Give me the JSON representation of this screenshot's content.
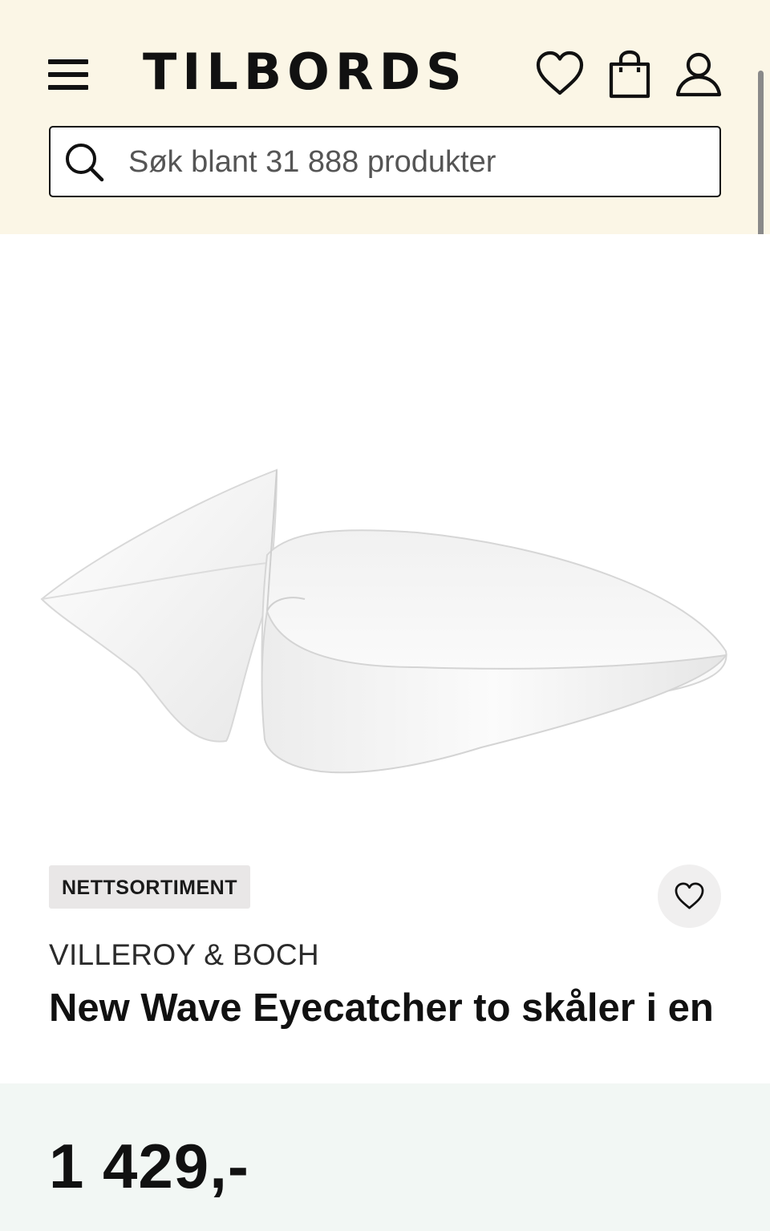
{
  "header": {
    "logo_text": "TILBORDS",
    "background": "#fbf6e6",
    "icons": [
      "hamburger-menu-icon",
      "heart-icon",
      "shopping-bag-icon",
      "user-icon"
    ]
  },
  "search": {
    "placeholder": "Søk blant 31 888 produkter",
    "value": ""
  },
  "product": {
    "badge": "NETTSORTIMENT",
    "brand": "VILLEROY & BOCH",
    "name": "New Wave Eyecatcher to skåler i en",
    "price": "1 429,-",
    "price_panel_color": "#f2f7f4"
  }
}
